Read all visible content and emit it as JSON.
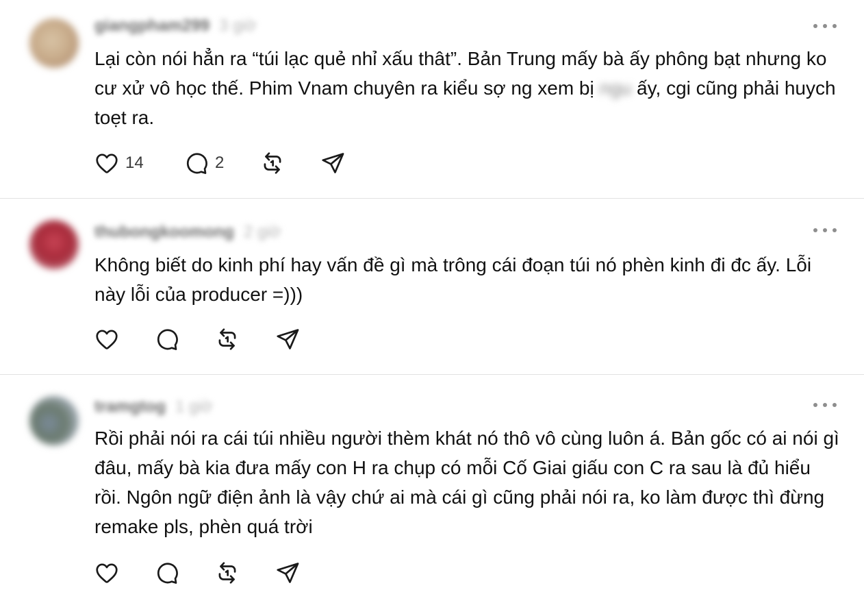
{
  "posts": [
    {
      "username": "giangpham299",
      "time": "3 giờ",
      "text_before": "Lại còn nói hẳn ra “túi lạc quẻ nhỉ xấu thât”. Bản Trung mấy bà ấy phông bạt nhưng ko cư xử vô học thế. Phim Vnam chuyên ra kiểu sợ ng xem bị",
      "redacted": "ngu",
      "text_after": "ấy, cgi cũng phải huych toẹt ra.",
      "likes": "14",
      "replies": "2"
    },
    {
      "username": "thubongkoomong",
      "time": "2 giờ",
      "text": "Không biết do kinh phí hay vấn đề gì mà trông cái đoạn túi nó phèn kinh đi đc ấy. Lỗi này lỗi của producer =)))",
      "likes": "",
      "replies": ""
    },
    {
      "username": "tramgtog",
      "time": "1 giờ",
      "text": "Rồi phải nói ra cái túi nhiều người thèm khát nó thô vô cùng luôn á. Bản gốc có ai nói gì đâu, mấy bà kia đưa mấy con H ra chụp có mỗi Cố Giai giấu con C ra sau là đủ hiểu rồi. Ngôn ngữ điện ảnh là vậy chứ ai mà cái gì cũng phải nói ra, ko làm được thì đừng remake pls, phèn quá trời",
      "likes": "",
      "replies": ""
    }
  ],
  "icons": {
    "like": "heart-icon",
    "reply": "comment-bubble-icon",
    "repost": "repost-icon",
    "share": "send-icon",
    "more": "more-options-icon"
  },
  "colors": {
    "background": "#ffffff",
    "text": "#111111",
    "icon": "#1a1a1a",
    "divider": "#e2e2e2",
    "muted": "#8e8e8e"
  }
}
